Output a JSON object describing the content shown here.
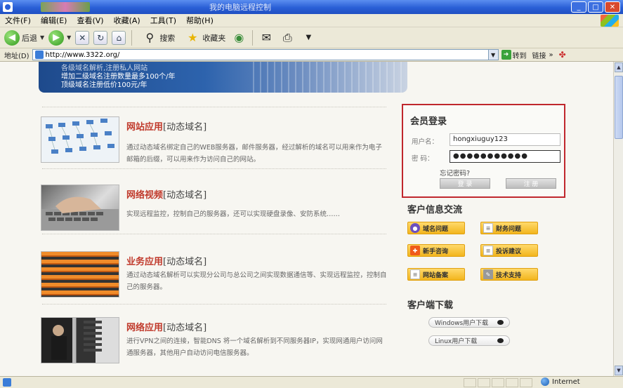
{
  "window": {
    "title": "我的电脑远程控制"
  },
  "menu": [
    "文件(F)",
    "编辑(E)",
    "查看(V)",
    "收藏(A)",
    "工具(T)",
    "帮助(H)"
  ],
  "toolbar": {
    "back": "后退",
    "search": "搜索",
    "favorites": "收藏夹"
  },
  "address": {
    "label": "地址(D)",
    "url": "http://www.3322.org/",
    "go": "转到",
    "links": "链接"
  },
  "banner": {
    "line1": "各级域名解析,注册私人网站",
    "line2": "增加二级域名注册数量最多100个/年",
    "line3": "顶级域名注册低价100元/年"
  },
  "services": [
    {
      "title": "网站应用",
      "subtitle": "[动态域名]",
      "desc": "通过动态域名绑定自己的WEB服务器，邮件服务器，经过解析的域名可以用来作为电子邮箱的后缀，可以用来作为访问自己的网站。"
    },
    {
      "title": "网络视频",
      "subtitle": "[动态域名]",
      "desc": "实现远程监控，控制自己的服务器，还可以实现硬盘录像、安防系统……"
    },
    {
      "title": "业务应用",
      "subtitle": "[动态域名]",
      "desc": "通过动态域名解析可以实现分公司与总公司之间实现数据通信等、实现远程监控，控制自己的服务器。"
    },
    {
      "title": "网络应用",
      "subtitle": "[动态域名]",
      "desc": "进行VPN之间的连接，智能DNS 将一个域名解析到不同服务器IP，实现网通用户访问网通服务器，其他用户自动访问电信服务器。"
    }
  ],
  "login": {
    "heading": "会员登录",
    "username_label": "用户名：",
    "username_value": "hongxiuguy123",
    "password_label": "密  码：",
    "password_value": "●●●●●●●●●●●",
    "forgot": "忘记密码?",
    "login_button": "登 录",
    "register_button": "注 册"
  },
  "customer_info": {
    "heading": "客户信息交流",
    "buttons": [
      "域名问题",
      "财务问题",
      "新手咨询",
      "投诉建议",
      "网站备案",
      "技术支持"
    ]
  },
  "client_download": {
    "heading": "客户端下载",
    "windows": "Windows用户下载",
    "linux": "Linux用户下载"
  },
  "status": {
    "zone": "Internet"
  }
}
